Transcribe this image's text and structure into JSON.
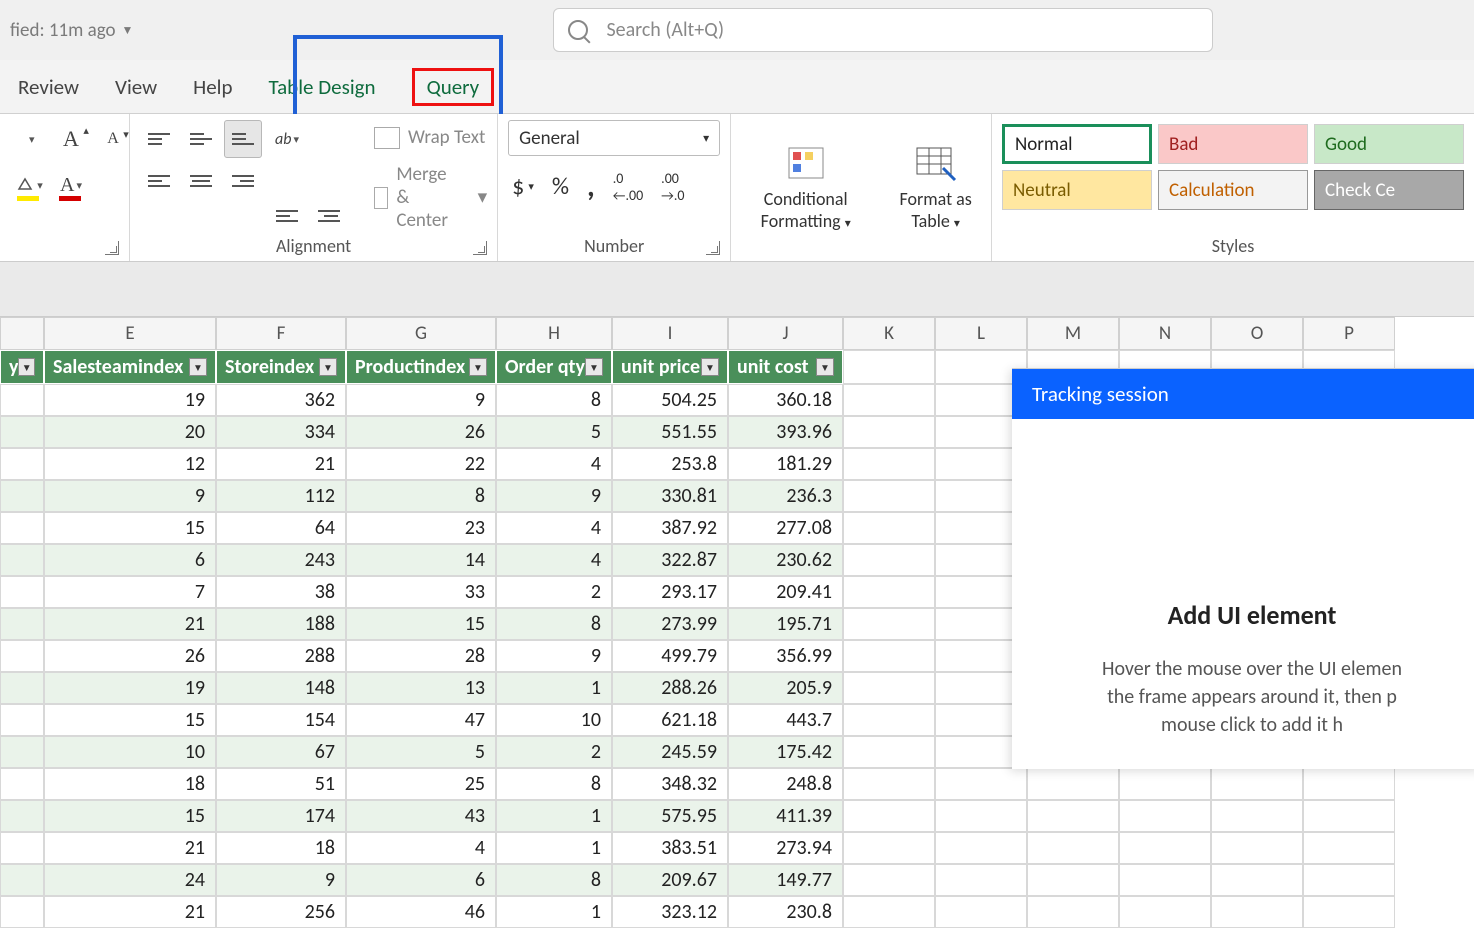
{
  "titlebar": {
    "status": "fied: 11m ago"
  },
  "search": {
    "placeholder": "Search (Alt+Q)"
  },
  "tabs": {
    "review": "Review",
    "view": "View",
    "help": "Help",
    "table_design": "Table Design",
    "query": "Query"
  },
  "ribbon": {
    "alignment_label": "Alignment",
    "number_label": "Number",
    "styles_label": "Styles",
    "wrap_text": "Wrap Text",
    "merge_center": "Merge & Center",
    "number_format": "General",
    "conditional_formatting": "Conditional Formatting",
    "format_as_table": "Format as Table",
    "styles": {
      "normal": "Normal",
      "bad": "Bad",
      "good": "Good",
      "neutral": "Neutral",
      "calculation": "Calculation",
      "check_cell": "Check Ce"
    }
  },
  "columns": {
    "D": "",
    "E": "E",
    "F": "F",
    "G": "G",
    "H": "H",
    "I": "I",
    "J": "J",
    "K": "K",
    "L": "L",
    "M": "M",
    "N": "N",
    "O": "O",
    "P": "P"
  },
  "headers": {
    "D": "y",
    "E": "Salesteamindex",
    "F": "Storeindex",
    "G": "Productindex",
    "H": "Order qty",
    "I": "unit price",
    "J": "unit cost"
  },
  "rows": [
    {
      "E": "19",
      "F": "362",
      "G": "9",
      "H": "8",
      "I": "504.25",
      "J": "360.18"
    },
    {
      "E": "20",
      "F": "334",
      "G": "26",
      "H": "5",
      "I": "551.55",
      "J": "393.96"
    },
    {
      "E": "12",
      "F": "21",
      "G": "22",
      "H": "4",
      "I": "253.8",
      "J": "181.29"
    },
    {
      "E": "9",
      "F": "112",
      "G": "8",
      "H": "9",
      "I": "330.81",
      "J": "236.3"
    },
    {
      "E": "15",
      "F": "64",
      "G": "23",
      "H": "4",
      "I": "387.92",
      "J": "277.08"
    },
    {
      "E": "6",
      "F": "243",
      "G": "14",
      "H": "4",
      "I": "322.87",
      "J": "230.62"
    },
    {
      "E": "7",
      "F": "38",
      "G": "33",
      "H": "2",
      "I": "293.17",
      "J": "209.41"
    },
    {
      "E": "21",
      "F": "188",
      "G": "15",
      "H": "8",
      "I": "273.99",
      "J": "195.71"
    },
    {
      "E": "26",
      "F": "288",
      "G": "28",
      "H": "9",
      "I": "499.79",
      "J": "356.99"
    },
    {
      "E": "19",
      "F": "148",
      "G": "13",
      "H": "1",
      "I": "288.26",
      "J": "205.9"
    },
    {
      "E": "15",
      "F": "154",
      "G": "47",
      "H": "10",
      "I": "621.18",
      "J": "443.7"
    },
    {
      "E": "10",
      "F": "67",
      "G": "5",
      "H": "2",
      "I": "245.59",
      "J": "175.42"
    },
    {
      "E": "18",
      "F": "51",
      "G": "25",
      "H": "8",
      "I": "348.32",
      "J": "248.8"
    },
    {
      "E": "15",
      "F": "174",
      "G": "43",
      "H": "1",
      "I": "575.95",
      "J": "411.39"
    },
    {
      "E": "21",
      "F": "18",
      "G": "4",
      "H": "1",
      "I": "383.51",
      "J": "273.94"
    },
    {
      "E": "24",
      "F": "9",
      "G": "6",
      "H": "8",
      "I": "209.67",
      "J": "149.77"
    },
    {
      "E": "21",
      "F": "256",
      "G": "46",
      "H": "1",
      "I": "323.12",
      "J": "230.8"
    }
  ],
  "overlay": {
    "title": "Tracking session",
    "heading": "Add UI element",
    "text1": "Hover the mouse over the UI elemen",
    "text2": "the frame appears around it, then p",
    "text3": "mouse click to add it h"
  }
}
